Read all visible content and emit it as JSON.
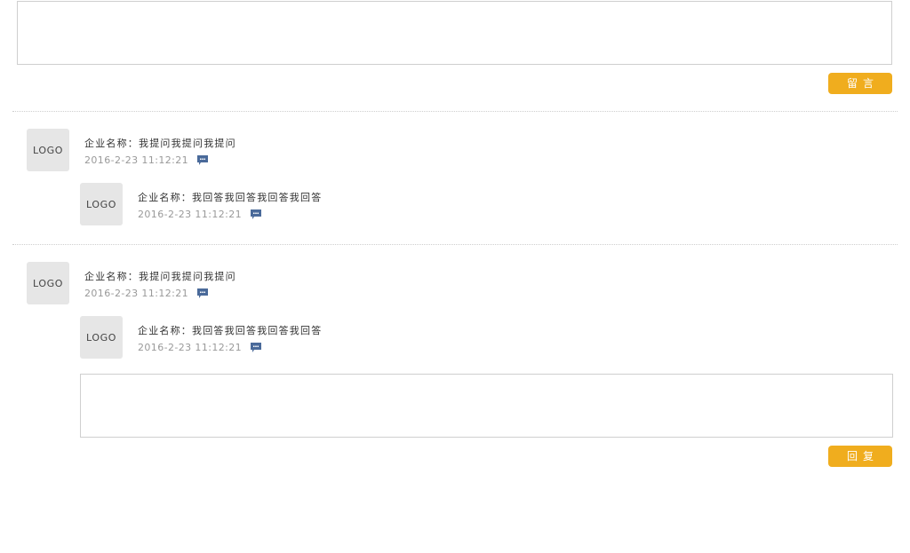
{
  "compose": {
    "placeholder": "",
    "submit_label": "留言"
  },
  "threads": [
    {
      "question": {
        "logo": "LOGO",
        "label": "企业名称：",
        "text": "我提问我提问我提问",
        "time": "2016-2-23 11:12:21"
      },
      "answer": {
        "logo": "LOGO",
        "label": "企业名称：",
        "text": "我回答我回答我回答我回答",
        "time": "2016-2-23 11:12:21"
      }
    },
    {
      "question": {
        "logo": "LOGO",
        "label": "企业名称：",
        "text": "我提问我提问我提问",
        "time": "2016-2-23 11:12:21"
      },
      "answer": {
        "logo": "LOGO",
        "label": "企业名称：",
        "text": "我回答我回答我回答我回答",
        "time": "2016-2-23 11:12:21"
      }
    }
  ],
  "reply": {
    "placeholder": "",
    "submit_label": "回复"
  },
  "icons": {
    "reply": "chat-bubble-icon",
    "accent_color": "#f0ad1e",
    "icon_color": "#4a6a9a"
  }
}
